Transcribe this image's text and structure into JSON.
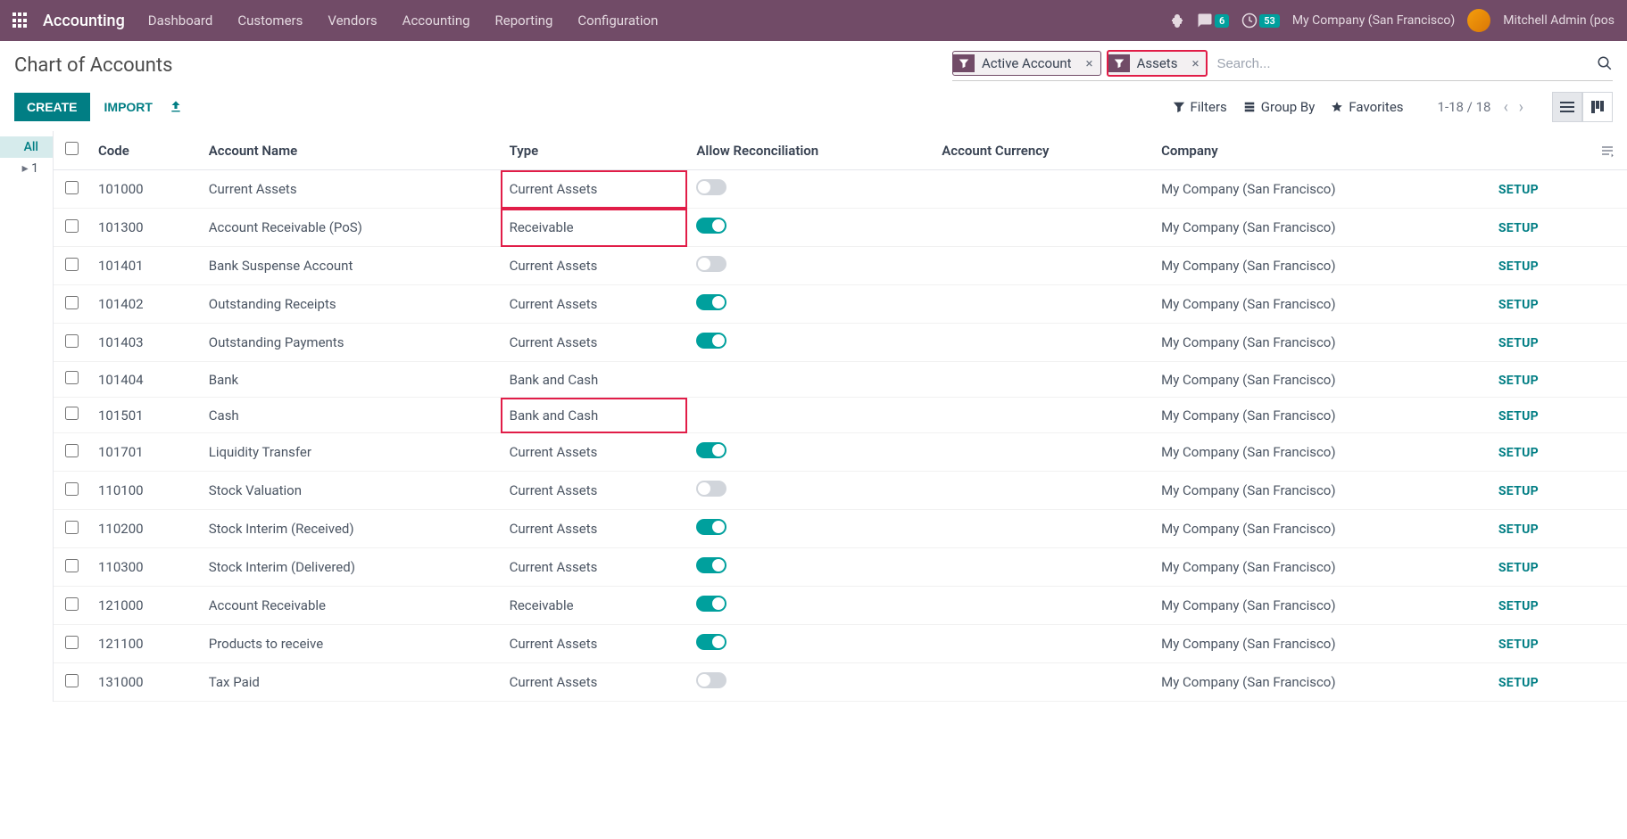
{
  "nav": {
    "brand": "Accounting",
    "links": [
      "Dashboard",
      "Customers",
      "Vendors",
      "Accounting",
      "Reporting",
      "Configuration"
    ],
    "msg_count": "6",
    "activity_count": "53",
    "company": "My Company (San Francisco)",
    "user": "Mitchell Admin (pos"
  },
  "page": {
    "title": "Chart of Accounts",
    "facets": [
      {
        "label": "Active Account"
      },
      {
        "label": "Assets"
      }
    ],
    "search_placeholder": "Search...",
    "create": "CREATE",
    "import": "IMPORT",
    "filters": "Filters",
    "groupby": "Group By",
    "favorites": "Favorites",
    "pager": "1-18 / 18"
  },
  "sidebar": {
    "items": [
      "All",
      "1"
    ]
  },
  "columns": {
    "code": "Code",
    "name": "Account Name",
    "type": "Type",
    "reconcile": "Allow Reconciliation",
    "currency": "Account Currency",
    "company": "Company"
  },
  "setup_label": "SETUP",
  "rows": [
    {
      "code": "101000",
      "name": "Current Assets",
      "type": "Current Assets",
      "reconcile": false,
      "currency": "",
      "company": "My Company (San Francisco)",
      "hlType": true
    },
    {
      "code": "101300",
      "name": "Account Receivable (PoS)",
      "type": "Receivable",
      "reconcile": true,
      "currency": "",
      "company": "My Company (San Francisco)",
      "hlType": true
    },
    {
      "code": "101401",
      "name": "Bank Suspense Account",
      "type": "Current Assets",
      "reconcile": false,
      "currency": "",
      "company": "My Company (San Francisco)"
    },
    {
      "code": "101402",
      "name": "Outstanding Receipts",
      "type": "Current Assets",
      "reconcile": true,
      "currency": "",
      "company": "My Company (San Francisco)"
    },
    {
      "code": "101403",
      "name": "Outstanding Payments",
      "type": "Current Assets",
      "reconcile": true,
      "currency": "",
      "company": "My Company (San Francisco)"
    },
    {
      "code": "101404",
      "name": "Bank",
      "type": "Bank and Cash",
      "reconcile": null,
      "currency": "",
      "company": "My Company (San Francisco)"
    },
    {
      "code": "101501",
      "name": "Cash",
      "type": "Bank and Cash",
      "reconcile": null,
      "currency": "",
      "company": "My Company (San Francisco)",
      "hlType": true
    },
    {
      "code": "101701",
      "name": "Liquidity Transfer",
      "type": "Current Assets",
      "reconcile": true,
      "currency": "",
      "company": "My Company (San Francisco)"
    },
    {
      "code": "110100",
      "name": "Stock Valuation",
      "type": "Current Assets",
      "reconcile": false,
      "currency": "",
      "company": "My Company (San Francisco)"
    },
    {
      "code": "110200",
      "name": "Stock Interim (Received)",
      "type": "Current Assets",
      "reconcile": true,
      "currency": "",
      "company": "My Company (San Francisco)"
    },
    {
      "code": "110300",
      "name": "Stock Interim (Delivered)",
      "type": "Current Assets",
      "reconcile": true,
      "currency": "",
      "company": "My Company (San Francisco)"
    },
    {
      "code": "121000",
      "name": "Account Receivable",
      "type": "Receivable",
      "reconcile": true,
      "currency": "",
      "company": "My Company (San Francisco)"
    },
    {
      "code": "121100",
      "name": "Products to receive",
      "type": "Current Assets",
      "reconcile": true,
      "currency": "",
      "company": "My Company (San Francisco)"
    },
    {
      "code": "131000",
      "name": "Tax Paid",
      "type": "Current Assets",
      "reconcile": false,
      "currency": "",
      "company": "My Company (San Francisco)"
    }
  ]
}
